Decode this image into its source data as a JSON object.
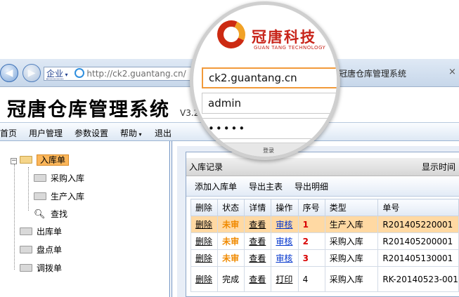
{
  "browser": {
    "address_zone": "企业",
    "address_url": "http://ck2.guantang.cn/",
    "tab_title": "冠唐仓库管理系统",
    "close_glyph": "×",
    "back_glyph": "◀",
    "forward_glyph": "▶"
  },
  "app": {
    "title": "冠唐仓库管理系统",
    "version": "V3.2"
  },
  "menu": {
    "items": [
      "首页",
      "用户管理",
      "参数设置",
      "帮助",
      "退出"
    ]
  },
  "sidebar": {
    "root": "入库单",
    "children": [
      "采购入库",
      "生产入库",
      "查找"
    ],
    "others": [
      "出库单",
      "盘点单",
      "调拨单"
    ],
    "collapse_glyph": "−"
  },
  "panel": {
    "title": "入库记录",
    "title_right": "显示时间范",
    "toolbar": [
      "添加入库单",
      "导出主表",
      "导出明细"
    ]
  },
  "table": {
    "headers": [
      "删除",
      "状态",
      "详情",
      "操作",
      "序号",
      "类型",
      "单号"
    ],
    "rows": [
      {
        "del": "删除",
        "status": "未审",
        "detail": "查看",
        "op": "审核",
        "idx": "1",
        "type": "生产入库",
        "no": "R201405220001"
      },
      {
        "del": "删除",
        "status": "未审",
        "detail": "查看",
        "op": "审核",
        "idx": "2",
        "type": "采购入库",
        "no": "R201405200001"
      },
      {
        "del": "删除",
        "status": "未审",
        "detail": "查看",
        "op": "审核",
        "idx": "3",
        "type": "采购入库",
        "no": "R201405130001"
      },
      {
        "del": "删除",
        "status": "完成",
        "detail": "查看",
        "op": "打印",
        "idx": "4",
        "type": "采购入库",
        "no": "RK-20140523-001"
      }
    ]
  },
  "login": {
    "brand_cn": "冠唐科技",
    "brand_en": "GUAN TANG TECHNOLOGY",
    "server": "ck2.guantang.cn",
    "username": "admin",
    "password_mask": "•••••",
    "button": "登录"
  },
  "colors": {
    "accent": "#f29a3a",
    "brand_red": "#c8241a",
    "status_pending": "#f08a00",
    "index_red": "#d80000",
    "selected_row": "#ffd9a3",
    "link": "#0033cc"
  }
}
